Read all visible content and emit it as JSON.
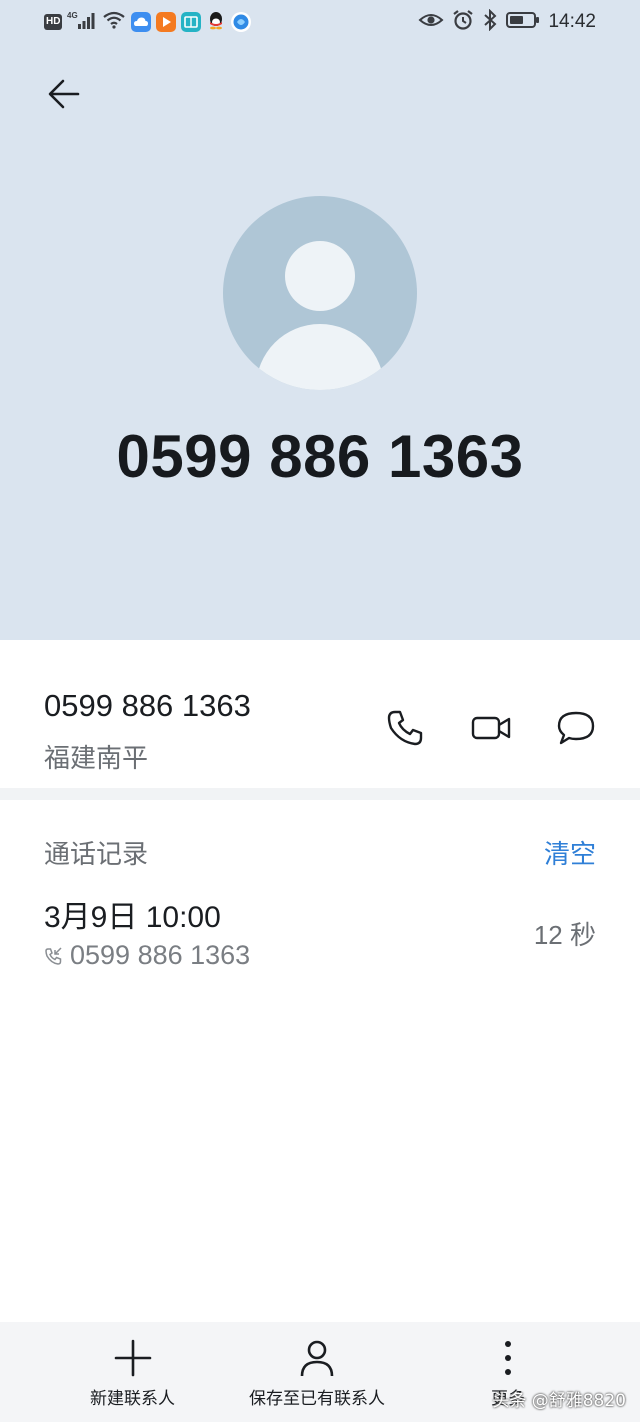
{
  "status_bar": {
    "time": "14:42",
    "network_badge": "HD",
    "network_type": "4G",
    "left_icons": [
      "hd-icon",
      "signal-icon",
      "wifi-icon",
      "cloud-app-icon",
      "video-app-icon",
      "reader-app-icon",
      "qq-icon",
      "browser-app-icon"
    ],
    "right_icons": [
      "eye-icon",
      "alarm-icon",
      "bluetooth-icon",
      "battery-icon"
    ]
  },
  "contact": {
    "display_number": "0599 886 1363",
    "number": "0599 886 1363",
    "region": "福建南平"
  },
  "call_log": {
    "title": "通话记录",
    "clear_label": "清空",
    "entries": [
      {
        "date": "3月9日 10:00",
        "number": "0599 886 1363",
        "duration": "12 秒"
      }
    ]
  },
  "bottom_bar": {
    "new_contact_label": "新建联系人",
    "save_existing_label": "保存至已有联系人",
    "more_label": "更多"
  },
  "watermark": "头条 @舒雅8820",
  "colors": {
    "header_bg": "#dae4ef",
    "avatar_bg": "#afc6d6",
    "accent": "#2f7fd7"
  }
}
